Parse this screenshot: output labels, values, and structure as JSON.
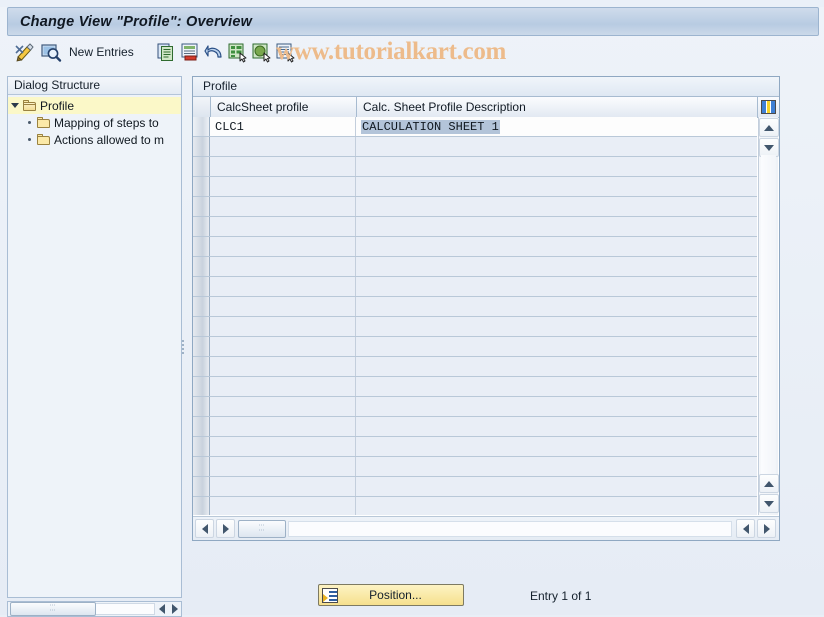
{
  "window": {
    "title": "Change View \"Profile\": Overview"
  },
  "watermark": {
    "text": "www.tutorialkart.com",
    "color": "#edbb8b"
  },
  "toolbar": {
    "new_entries_label": "New Entries",
    "icons": [
      {
        "name": "edit-pencil-icon",
        "title": "Change"
      },
      {
        "name": "display-magnifier-icon",
        "title": "Display"
      },
      {
        "name": "copy-icon",
        "title": "Copy As..."
      },
      {
        "name": "delete-icon",
        "title": "Delete"
      },
      {
        "name": "undo-icon",
        "title": "Undo Change"
      },
      {
        "name": "select-all-icon",
        "title": "Select All"
      },
      {
        "name": "deselect-all-icon",
        "title": "Deselect All"
      },
      {
        "name": "select-block-icon",
        "title": "Select Block"
      }
    ]
  },
  "tree": {
    "header": "Dialog Structure",
    "items": [
      {
        "label": "Profile",
        "selected": true,
        "level": 0,
        "expanded": true,
        "icon": "open-folder-icon"
      },
      {
        "label": "Mapping of steps to",
        "selected": false,
        "level": 1,
        "expanded": false,
        "icon": "closed-folder-icon"
      },
      {
        "label": "Actions allowed to m",
        "selected": false,
        "level": 1,
        "expanded": false,
        "icon": "closed-folder-icon"
      }
    ]
  },
  "grid": {
    "title": "Profile",
    "columns": [
      "CalcSheet profile",
      "Calc. Sheet Profile Description"
    ],
    "config_icon": "column-configuration-icon",
    "rows": [
      {
        "profile": "CLC1",
        "description": "CALCULATION SHEET 1",
        "description_selected": true
      }
    ],
    "empty_row_count": 19
  },
  "footer": {
    "position_button": "Position...",
    "entry_status": "Entry 1 of 1"
  },
  "scrollbars": {
    "vertical_up": "scroll-up-arrow",
    "vertical_down": "scroll-down-arrow",
    "horizontal_left": "scroll-left-arrow",
    "horizontal_right": "scroll-right-arrow"
  }
}
